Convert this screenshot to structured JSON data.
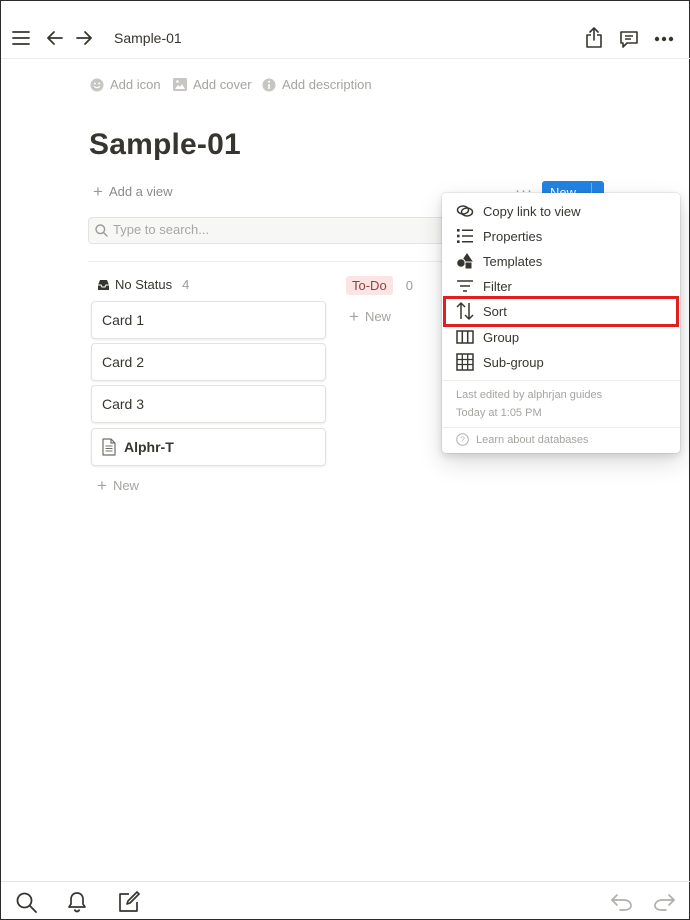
{
  "topbar": {
    "breadcrumb": "Sample-01",
    "icons": [
      "menu-icon",
      "back-arrow-icon",
      "forward-arrow-icon",
      "share-icon",
      "comment-icon",
      "more-icon"
    ]
  },
  "page": {
    "add_icon": "Add icon",
    "add_cover": "Add cover",
    "add_description": "Add description",
    "title": "Sample-01"
  },
  "toolbar": {
    "add_view": "Add a view",
    "more": "···",
    "new_button": "New",
    "new_caret": "⌄"
  },
  "search": {
    "placeholder": "Type to search..."
  },
  "board": {
    "columns": [
      {
        "title": "No Status",
        "count": "4",
        "new_label": "New"
      },
      {
        "title": "To-Do",
        "count": "0",
        "new_label": "New"
      }
    ],
    "cards": [
      {
        "title": "Card 1"
      },
      {
        "title": "Card 2"
      },
      {
        "title": "Card 3"
      },
      {
        "title": "Alphr-T"
      }
    ]
  },
  "menu": {
    "items": [
      {
        "label": "Copy link to view",
        "icon": "link-icon"
      },
      {
        "label": "Properties",
        "icon": "list-icon"
      },
      {
        "label": "Templates",
        "icon": "shapes-icon"
      },
      {
        "label": "Filter",
        "icon": "filter-icon"
      },
      {
        "label": "Sort",
        "icon": "sort-icon"
      },
      {
        "label": "Group",
        "icon": "columns-icon"
      },
      {
        "label": "Sub-group",
        "icon": "grid-icon"
      }
    ],
    "highlight_color": "#e02020",
    "last_edited": "Last edited by alphrjan guides",
    "last_edited_time": "Today at 1:05 PM",
    "learn": "Learn about databases"
  },
  "bottombar": {
    "icons": [
      "search-icon",
      "bell-icon",
      "compose-icon",
      "undo-icon",
      "redo-icon"
    ]
  },
  "colors": {
    "accent": "#2383e2",
    "todo_pill_bg": "#fbe4e4",
    "todo_pill_text": "#93413d",
    "text": "#37352f"
  }
}
